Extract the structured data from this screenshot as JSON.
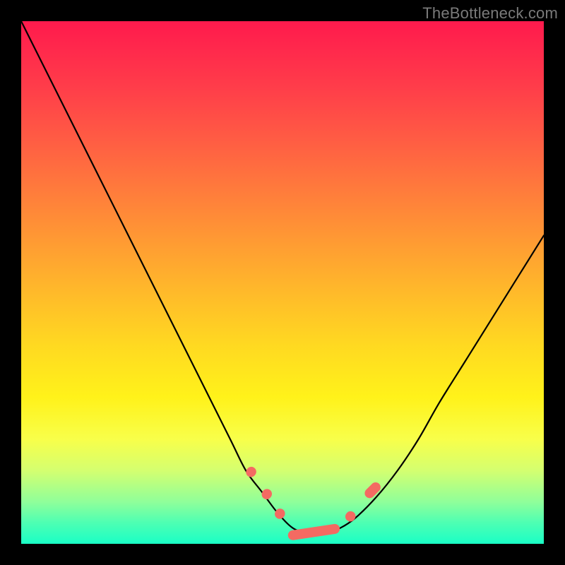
{
  "watermark": "TheBottleneck.com",
  "colors": {
    "gradient_top": "#ff1a4d",
    "gradient_bottom": "#1affc6",
    "curve": "#000000",
    "marker": "#f46a62",
    "frame": "#000000"
  },
  "chart_data": {
    "type": "line",
    "title": "",
    "xlabel": "",
    "ylabel": "",
    "xlim": [
      0,
      100
    ],
    "ylim": [
      0,
      100
    ],
    "grid": false,
    "legend": false,
    "series": [
      {
        "name": "bottleneck-curve",
        "x": [
          0,
          5,
          10,
          15,
          20,
          25,
          30,
          35,
          40,
          43,
          46,
          49,
          52,
          55,
          58,
          61,
          64,
          68,
          72,
          76,
          80,
          85,
          90,
          95,
          100
        ],
        "y": [
          100,
          90,
          80,
          70,
          60,
          50,
          40,
          30,
          20,
          14,
          10,
          6,
          3,
          2,
          2,
          3,
          5,
          9,
          14,
          20,
          27,
          35,
          43,
          51,
          59
        ]
      }
    ],
    "markers": [
      {
        "name": "left-segment-1",
        "x_range": [
          43.0,
          45.0
        ],
        "y_range": [
          12.5,
          15.0
        ]
      },
      {
        "name": "left-segment-2",
        "x_range": [
          46.0,
          48.0
        ],
        "y_range": [
          8.0,
          11.0
        ]
      },
      {
        "name": "left-segment-3",
        "x_range": [
          48.5,
          50.5
        ],
        "y_range": [
          4.5,
          7.0
        ]
      },
      {
        "name": "valley-floor",
        "x_range": [
          51.0,
          61.0
        ],
        "y_range": [
          1.5,
          3.0
        ]
      },
      {
        "name": "right-segment-1",
        "x_range": [
          62.0,
          64.0
        ],
        "y_range": [
          4.0,
          6.5
        ]
      },
      {
        "name": "right-segment-2",
        "x_range": [
          65.5,
          69.0
        ],
        "y_range": [
          8.5,
          12.0
        ]
      }
    ]
  }
}
